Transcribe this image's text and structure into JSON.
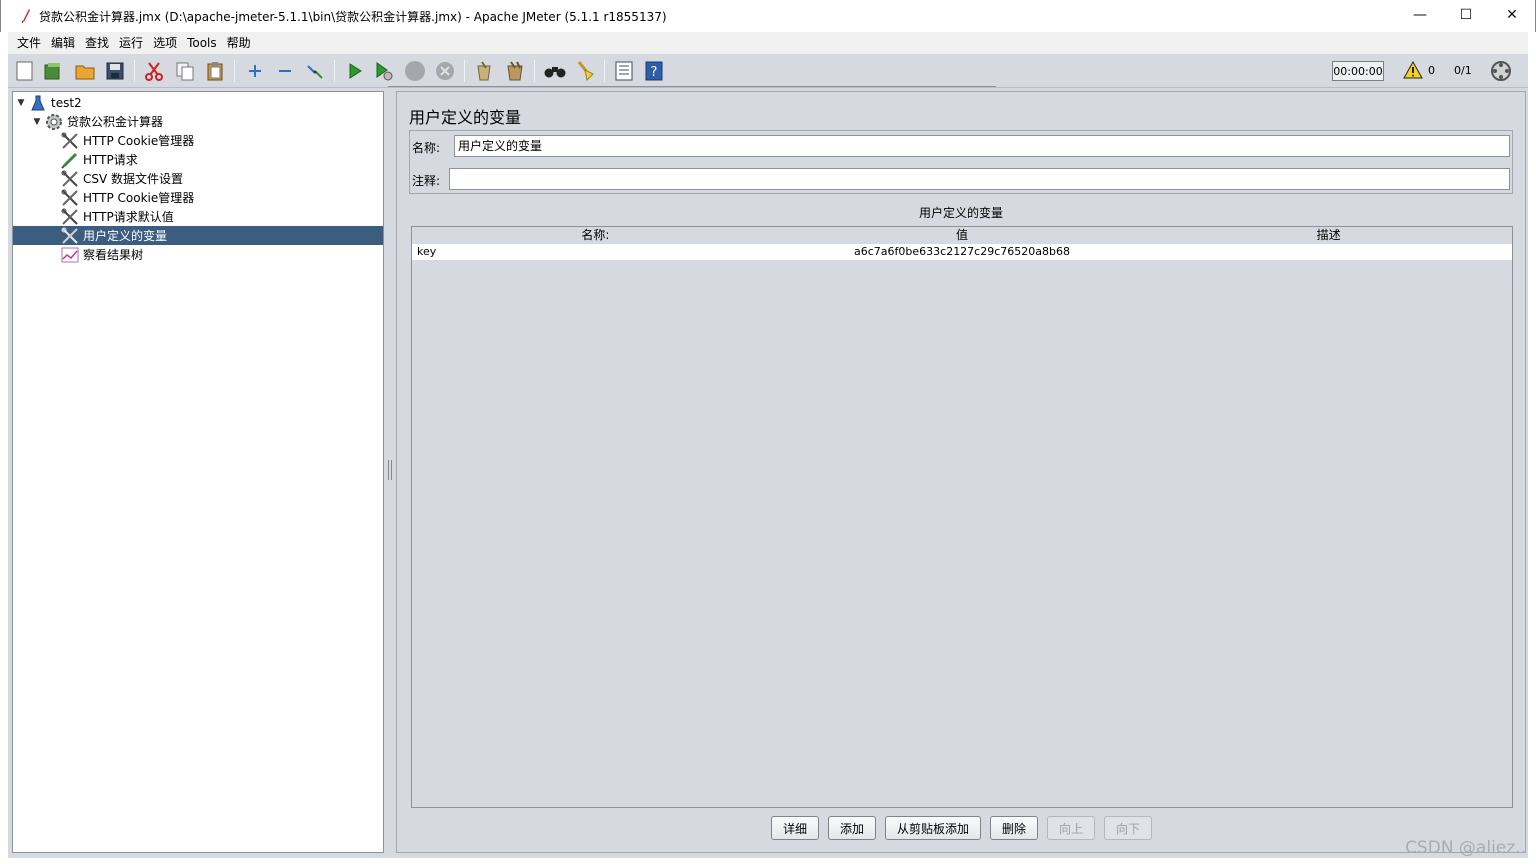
{
  "window": {
    "title": "贷款公积金计算器.jmx (D:\\apache-jmeter-5.1.1\\bin\\贷款公积金计算器.jmx) - Apache JMeter (5.1.1 r1855137)",
    "minimize": "—",
    "maximize": "☐",
    "close": "✕"
  },
  "menu": [
    "文件",
    "编辑",
    "查找",
    "运行",
    "选项",
    "Tools",
    "帮助"
  ],
  "toolbar": {
    "timer": "00:00:00",
    "warning_count": "0",
    "threads": "0/1"
  },
  "tree": {
    "root": "test2",
    "plan": "贷款公积金计算器",
    "items": [
      {
        "label": "HTTP Cookie管理器",
        "icon": "wrench-icon"
      },
      {
        "label": "HTTP请求",
        "icon": "pipette-icon"
      },
      {
        "label": "CSV 数据文件设置",
        "icon": "wrench-icon"
      },
      {
        "label": "HTTP Cookie管理器",
        "icon": "wrench-icon"
      },
      {
        "label": "HTTP请求默认值",
        "icon": "wrench-icon"
      },
      {
        "label": "用户定义的变量",
        "icon": "wrench-icon",
        "selected": true
      },
      {
        "label": "察看结果树",
        "icon": "graph-icon"
      }
    ]
  },
  "panel": {
    "title": "用户定义的变量",
    "name_label": "名称:",
    "name_value": "用户定义的变量",
    "comment_label": "注释:",
    "comment_value": "",
    "table_title": "用户定义的变量",
    "columns": [
      "名称:",
      "值",
      "描述"
    ],
    "rows": [
      {
        "name": "key",
        "value": "a6c7a6f0be633c2127c29c76520a8b68",
        "desc": ""
      }
    ],
    "buttons": {
      "detail": "详细",
      "add": "添加",
      "add_clipboard": "从剪贴板添加",
      "delete": "删除",
      "up": "向上",
      "down": "向下"
    }
  },
  "watermark": "CSDN @aliez..",
  "colors": {
    "selection": "#3b5e80",
    "panel_bg": "#d6d9df"
  }
}
